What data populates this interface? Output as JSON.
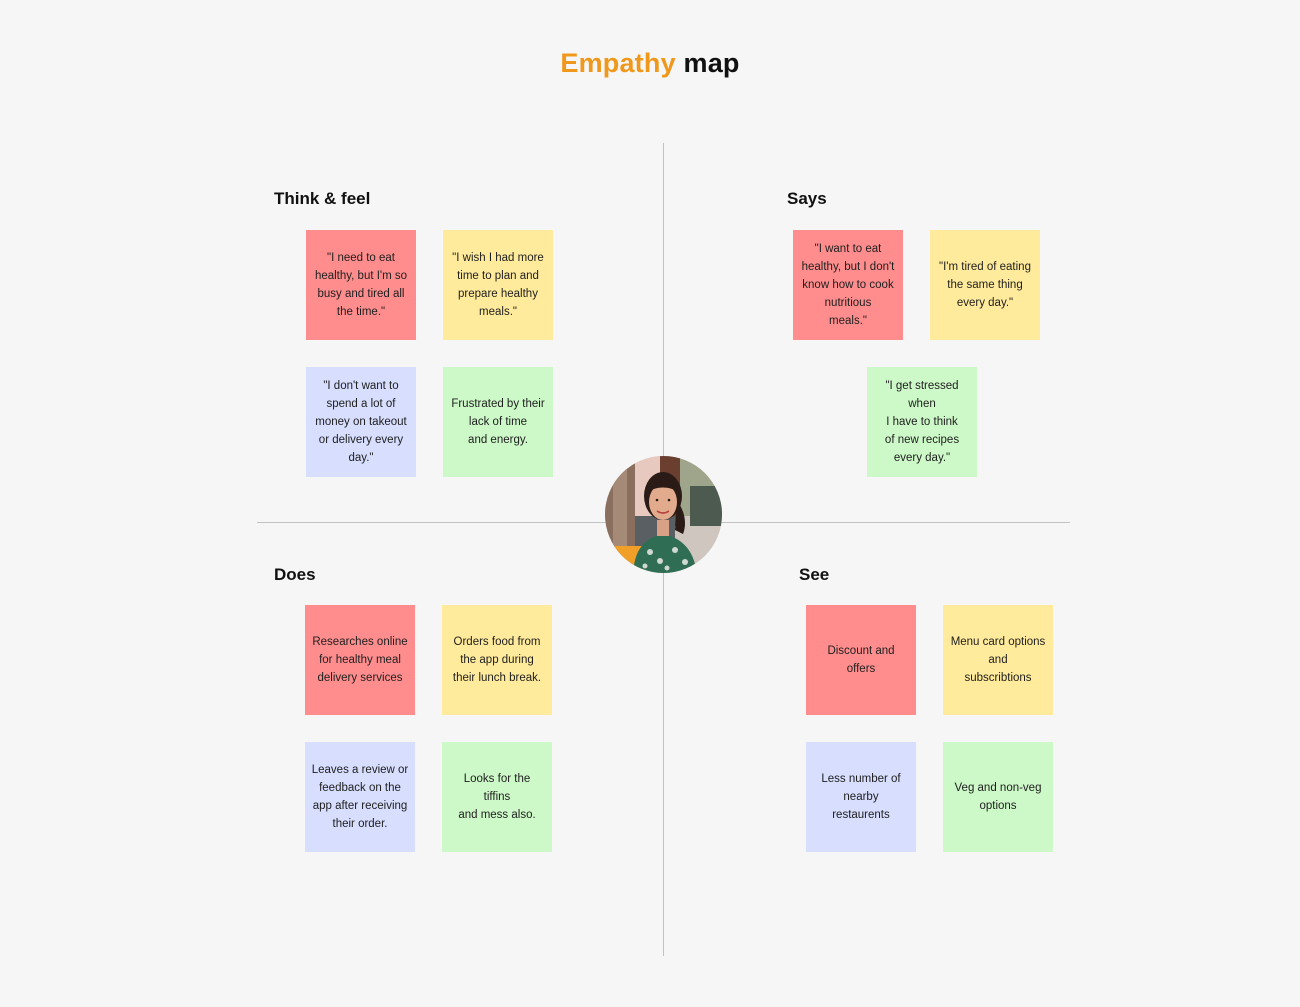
{
  "title": {
    "accent": "Empathy",
    "rest": "map",
    "accent_color": "#f0981c"
  },
  "colors": {
    "red": "#ff8d8d",
    "yellow": "#ffeb9b",
    "blue": "#d7defe",
    "green": "#cdf8c8",
    "divider": "#c2c2c2",
    "background": "#f6f6f6"
  },
  "persona": {
    "label": "persona photo"
  },
  "quadrants": {
    "think_feel": {
      "title": "Think & feel",
      "notes": [
        {
          "color": "red",
          "text": "\"I need to eat\nhealthy, but I'm so\nbusy and tired all\nthe time.\""
        },
        {
          "color": "yellow",
          "text": "\"I wish I had more\ntime to plan and\nprepare healthy\nmeals.\""
        },
        {
          "color": "blue",
          "text": "\"I don't want to\nspend a lot of\nmoney on takeout\nor delivery every\nday.\""
        },
        {
          "color": "green",
          "text": "Frustrated by their\nlack of time\nand energy."
        }
      ]
    },
    "says": {
      "title": "Says",
      "notes": [
        {
          "color": "red",
          "text": "\"I want to eat\nhealthy, but I don't\nknow how to cook\nnutritious\nmeals.\""
        },
        {
          "color": "yellow",
          "text": "\"I'm tired of eating\nthe same thing\nevery day.\""
        },
        {
          "color": "green",
          "text": "\"I get stressed when\nI have to think\nof new recipes\nevery day.\""
        }
      ]
    },
    "does": {
      "title": "Does",
      "notes": [
        {
          "color": "red",
          "text": "Researches online\nfor healthy meal\ndelivery services"
        },
        {
          "color": "yellow",
          "text": "Orders food from\nthe app during\ntheir lunch break."
        },
        {
          "color": "blue",
          "text": "Leaves a review or\nfeedback on the\napp after receiving\ntheir order."
        },
        {
          "color": "green",
          "text": "Looks for the\ntiffins\nand mess also."
        }
      ]
    },
    "see": {
      "title": "See",
      "notes": [
        {
          "color": "red",
          "text": "Discount and\noffers"
        },
        {
          "color": "yellow",
          "text": "Menu card options\nand\nsubscribtions"
        },
        {
          "color": "blue",
          "text": "Less number of\nnearby\nrestaurents"
        },
        {
          "color": "green",
          "text": "Veg and non-veg\noptions"
        }
      ]
    }
  }
}
